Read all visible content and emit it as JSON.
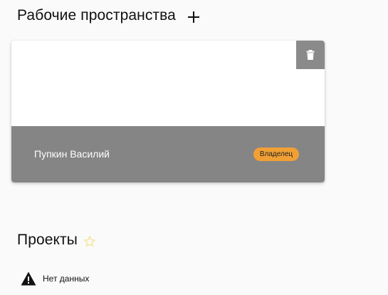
{
  "workspaces": {
    "title": "Рабочие пространства",
    "add_icon": "plus-icon",
    "cards": [
      {
        "owner_name": "Пупкин Василий",
        "role_badge": "Владелец",
        "delete_icon": "trash-icon"
      }
    ]
  },
  "projects": {
    "title": "Проекты",
    "star_icon": "star-outline-icon",
    "empty_text": "Нет данных",
    "empty_icon": "warning-icon"
  },
  "colors": {
    "card_footer": "#858585",
    "badge": "#f1a035",
    "delete_button": "#8a8a8a",
    "star": "#f5e7a8"
  }
}
